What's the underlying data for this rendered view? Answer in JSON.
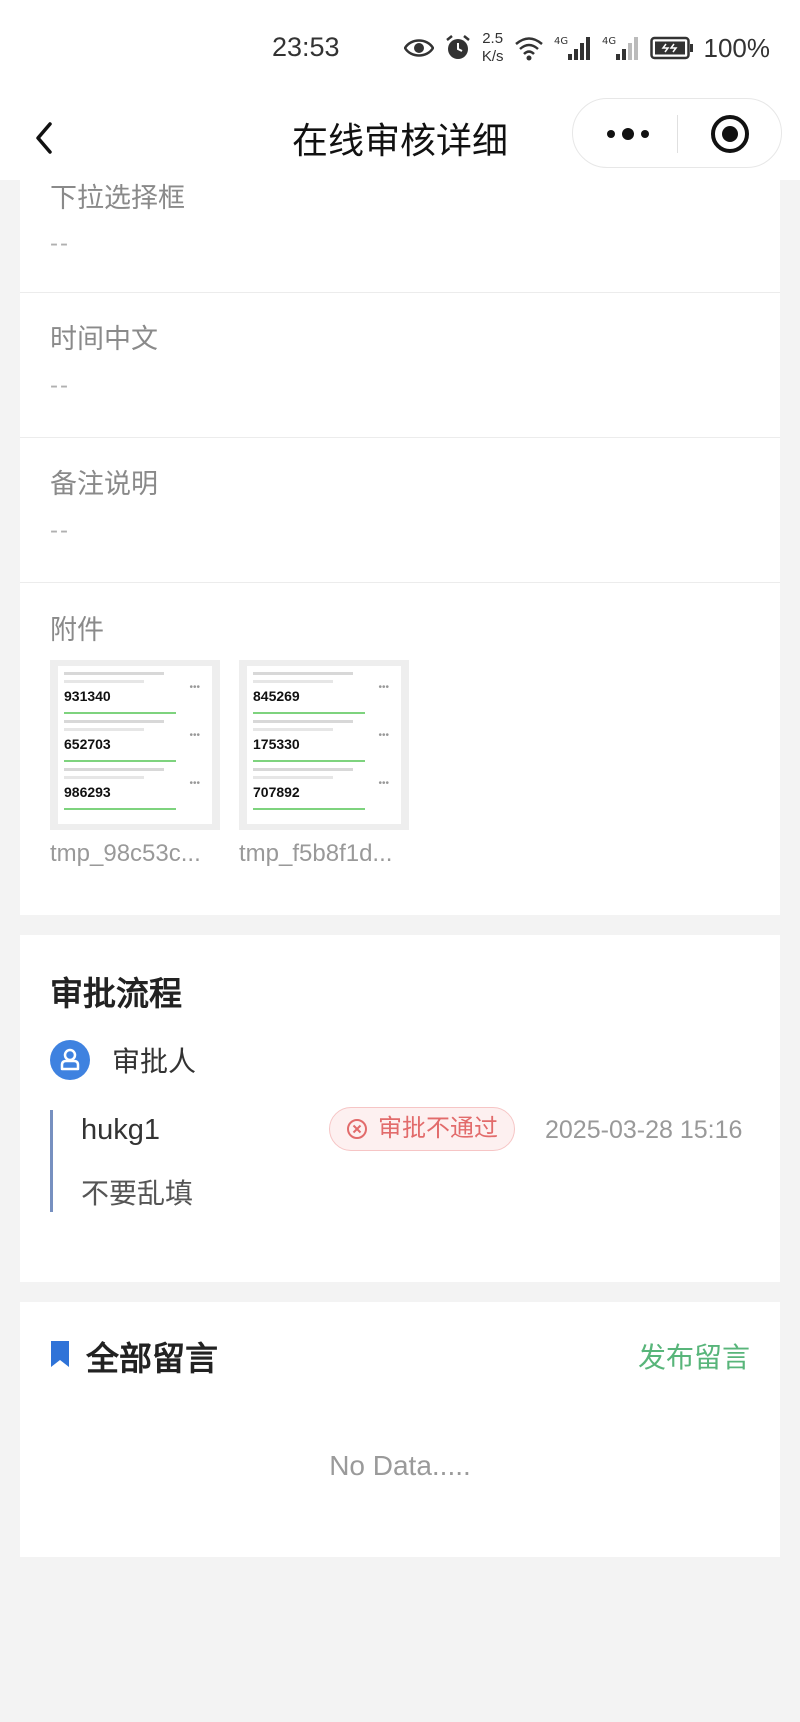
{
  "status_bar": {
    "time": "23:53",
    "net_speed_value": "2.5",
    "net_speed_unit": "K/s",
    "battery": "100%",
    "icons": [
      "eye-icon",
      "alarm-icon",
      "wifi-icon",
      "signal-4g-icon",
      "signal-4g-icon",
      "battery-icon"
    ]
  },
  "nav": {
    "title": "在线审核详细",
    "back_icon": "chevron-left-icon",
    "more_icon": "more-dots-icon",
    "close_icon": "target-icon"
  },
  "fields": [
    {
      "label": "下拉选择框",
      "value": "--"
    },
    {
      "label": "时间中文",
      "value": "--"
    },
    {
      "label": "备注说明",
      "value": "--"
    }
  ],
  "attachments": {
    "label": "附件",
    "files": [
      {
        "name": "tmp_98c53c...",
        "codes": [
          "931340",
          "652703",
          "986293"
        ]
      },
      {
        "name": "tmp_f5b8f1d...",
        "codes": [
          "845269",
          "175330",
          "707892"
        ]
      }
    ]
  },
  "approval": {
    "title": "审批流程",
    "approver_label": "审批人",
    "item": {
      "name": "hukg1",
      "status": "审批不通过",
      "time": "2025-03-28 15:16",
      "comment": "不要乱填"
    }
  },
  "comments": {
    "title": "全部留言",
    "post_label": "发布留言",
    "empty_text": "No Data....."
  },
  "colors": {
    "accent_green": "#58b57a",
    "approver_blue": "#3f82e0",
    "reject_red": "#e26b6b",
    "bookmark_blue": "#2f73d8"
  }
}
